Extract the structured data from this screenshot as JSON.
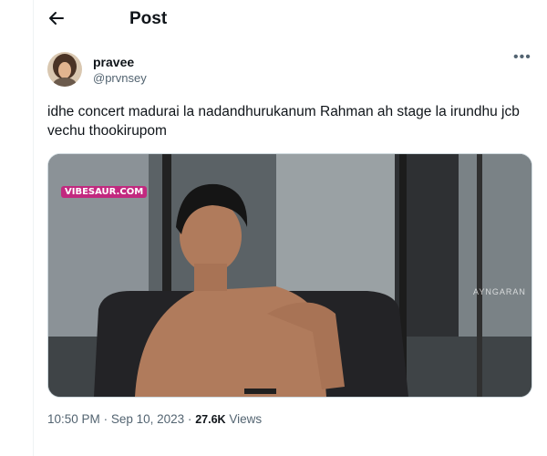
{
  "header": {
    "title": "Post"
  },
  "tweet": {
    "display_name": "pravee",
    "handle": "@prvnsey",
    "text": "idhe concert madurai la nadandhurukanum Rahman ah stage la irundhu jcb vechu thookirupom",
    "media": {
      "watermark_left": "VIBESAUR.COM",
      "watermark_right": "AYNGARAN"
    },
    "time": "10:50 PM",
    "separator": "·",
    "date": "Sep 10, 2023",
    "views_count": "27.6K",
    "views_label": "Views"
  },
  "colors": {
    "text": "#0f1419",
    "secondary": "#536471",
    "border": "#eff3f4"
  }
}
